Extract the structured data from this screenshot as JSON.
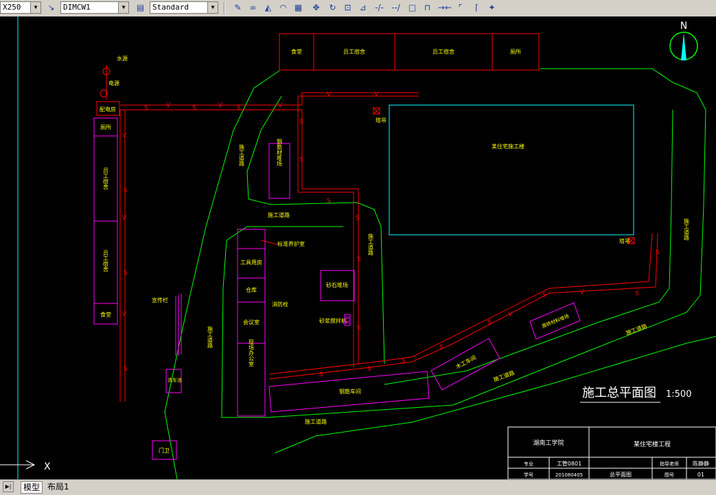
{
  "toolbar": {
    "scale_combo": "X250",
    "dimstyle_combo": "DIMCW1",
    "textstyle_combo": "Standard",
    "icons": [
      "dimstyle-icon",
      "textstyle-icon",
      "pencil-icon",
      "link-icon",
      "mirror-icon",
      "offset-icon",
      "array-icon",
      "move-icon",
      "rotate-icon",
      "scale-icon",
      "stretch-icon",
      "trim-icon",
      "extend-icon",
      "break-icon",
      "join-icon",
      "chamfer-icon",
      "fillet-icon",
      "explode-icon"
    ]
  },
  "tabs": {
    "model": "模型",
    "layout1": "布局1"
  },
  "drawing": {
    "title": "施工总平面图",
    "scale": "1:500",
    "north": "N",
    "ucs_x": "X",
    "top_buildings": [
      "食堂",
      "员工宿舍",
      "员工宿舍",
      "厕所"
    ],
    "left_labels": {
      "water_source": "水源",
      "power_source": "电源",
      "distribution": "配电房"
    },
    "left_buildings": [
      "厕所",
      "员工宿舍",
      "员工宿舍",
      "食堂"
    ],
    "road_labels": {
      "road_a": "施工道路",
      "road_b": "施工道路",
      "road_c": "施工道路",
      "road_d": "施工道路",
      "road_e": "施工道路",
      "road_f": "施工道路",
      "road_g": "施工道路",
      "road_h": "施工道路"
    },
    "main_building": "某住宅施工楼",
    "tower_crane_1": "塔吊",
    "tower_crane_2": "塔吊",
    "rebar_yard": "钢筋材堆场",
    "office_column": [
      "工具用房",
      "仓库",
      "会议室",
      "现场办公室"
    ],
    "fire_hydrant": "消防栓",
    "standard_guard": "标准养护室",
    "sand_yard": "砂石堆场",
    "mixer": "砂浆搅拌机",
    "notice_board": "宣传栏",
    "wash_pit": "洗车池",
    "gate": "门卫",
    "steel_shed": "钢筋车间",
    "wood_shed": "木工车间",
    "formwork_yard": "周转材料堆场",
    "title_block": {
      "school": "湖南工学院",
      "project": "某住宅楼工程",
      "major_label": "专业",
      "major_value": "工管0801",
      "id_label": "学号",
      "id_value": "201080405",
      "drawing_name": "总平面图",
      "designer_label": "指导老师",
      "designer_value": "陈静静",
      "sheet_label": "图号",
      "sheet_value": "01"
    }
  },
  "colors": {
    "road": "#00ff00",
    "pipe": "#ff0000",
    "building": "#ff00ff",
    "text": "#ffff00",
    "outline": "#ff0000",
    "main": "#00ffff"
  }
}
